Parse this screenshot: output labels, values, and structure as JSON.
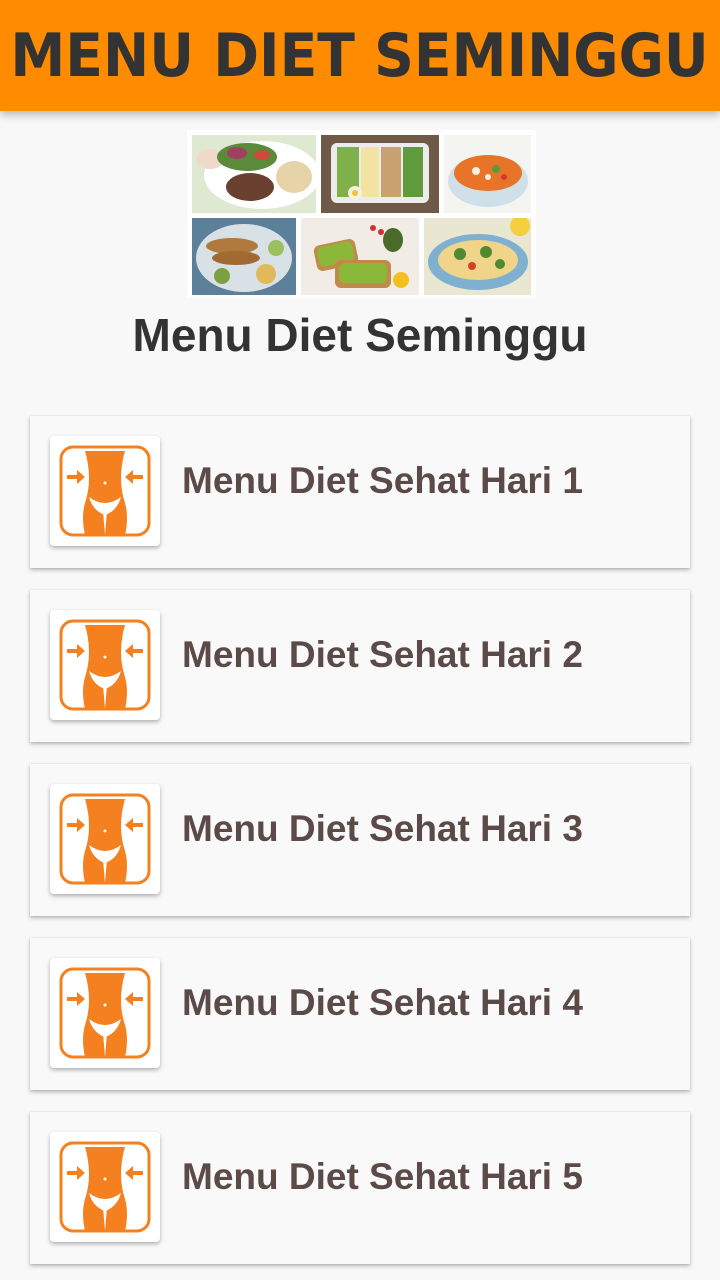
{
  "appbar": {
    "title": "MENU DIET SEMINGGU",
    "color": "#ff8c00"
  },
  "header_image": {
    "description_icon": "food-collage-image"
  },
  "page": {
    "title": "Menu Diet Seminggu"
  },
  "menu": {
    "items": [
      {
        "label": "Menu Diet Sehat Hari 1",
        "icon": "slim-waist-icon"
      },
      {
        "label": "Menu Diet Sehat Hari 2",
        "icon": "slim-waist-icon"
      },
      {
        "label": "Menu Diet Sehat Hari 3",
        "icon": "slim-waist-icon"
      },
      {
        "label": "Menu Diet Sehat Hari 4",
        "icon": "slim-waist-icon"
      },
      {
        "label": "Menu Diet Sehat Hari 5",
        "icon": "slim-waist-icon"
      }
    ]
  },
  "colors": {
    "accent": "#ff8c00",
    "icon_orange": "#f5801f",
    "label_text": "#5b4a47",
    "title_text": "#333333"
  }
}
